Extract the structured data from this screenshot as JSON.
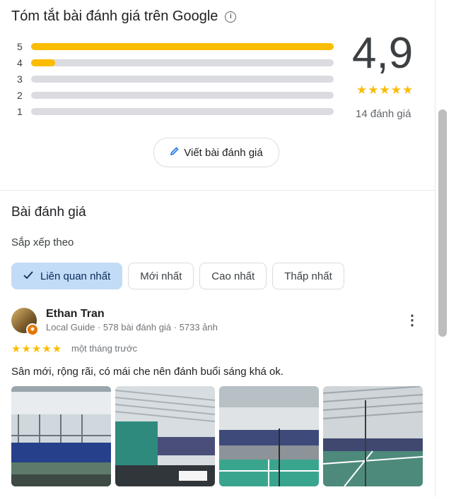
{
  "summary": {
    "title": "Tóm tắt bài đánh giá trên Google",
    "info_icon": "ⓘ",
    "bars": [
      {
        "label": "5",
        "fraction": 1.0
      },
      {
        "label": "4",
        "fraction": 0.08
      },
      {
        "label": "3",
        "fraction": 0.0
      },
      {
        "label": "2",
        "fraction": 0.0
      },
      {
        "label": "1",
        "fraction": 0.0
      }
    ],
    "rating": "4,9",
    "stars": "★★★★★",
    "review_count": "14 đánh giá",
    "write_review_label": "Viết bài đánh giá"
  },
  "reviews_section": {
    "title": "Bài đánh giá",
    "sort_label": "Sắp xếp theo",
    "sort_options": [
      "Liên quan nhất",
      "Mới nhất",
      "Cao nhất",
      "Thấp nhất"
    ],
    "selected_index": 0
  },
  "review": {
    "author": "Ethan Tran",
    "meta": "Local Guide · 578 bài đánh giá · 5733 ảnh",
    "stars": "★★★★★",
    "time": "một tháng trước",
    "text": "Sân mới, rộng rãi, có mái che nên đánh buổi sáng khá ok."
  },
  "colors": {
    "star": "#fbbc04",
    "selected_chip": "#c2dbf7",
    "accent": "#1a73e8",
    "court": "#3aa58f"
  }
}
